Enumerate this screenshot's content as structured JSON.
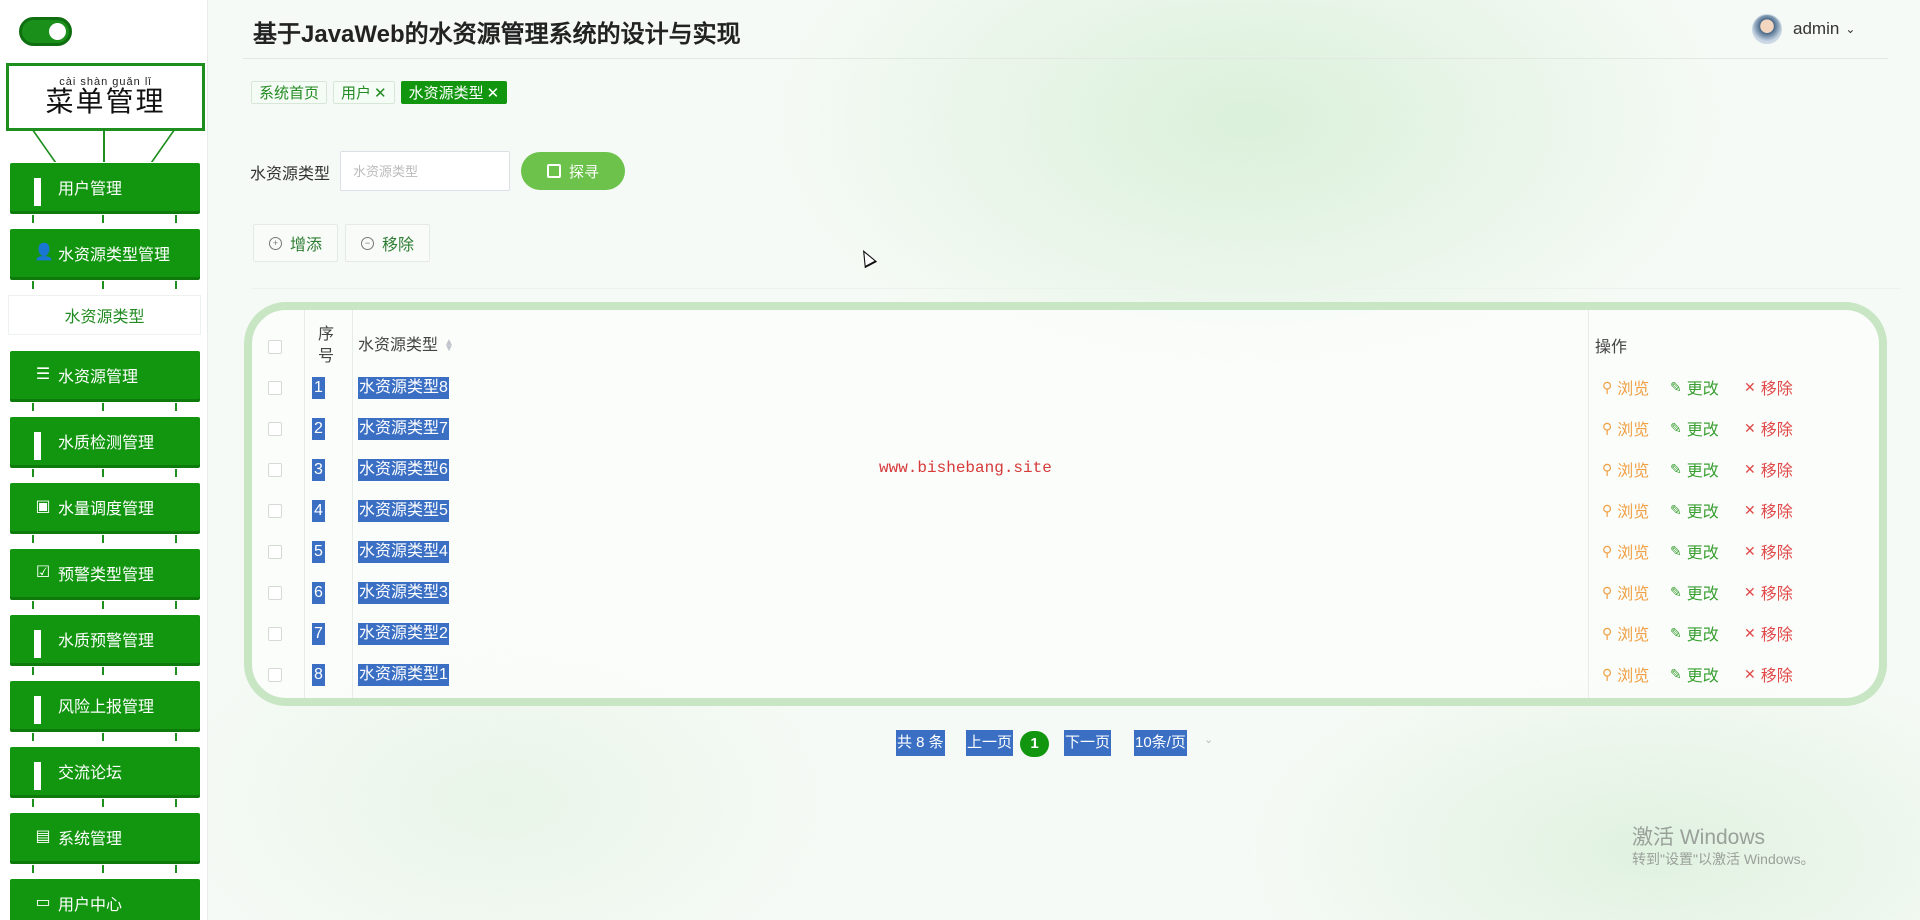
{
  "app": {
    "title": "基于JavaWeb的水资源管理系统的设计与实现",
    "user": "admin"
  },
  "sidebar": {
    "title_pinyin": "cài  shàn guǎn  lǐ",
    "title": "菜单管理",
    "items": [
      {
        "label": "用户管理",
        "icon": "grid-icon"
      },
      {
        "label": "水资源类型管理",
        "icon": "user-icon"
      },
      {
        "label": "水资源管理",
        "icon": "sliders-icon"
      },
      {
        "label": "水质检测管理",
        "icon": "grid-icon"
      },
      {
        "label": "水量调度管理",
        "icon": "wallet-icon"
      },
      {
        "label": "预警类型管理",
        "icon": "clipboard-check-icon"
      },
      {
        "label": "水质预警管理",
        "icon": "grid-icon"
      },
      {
        "label": "风险上报管理",
        "icon": "grid-icon"
      },
      {
        "label": "交流论坛",
        "icon": "grid-icon"
      },
      {
        "label": "系统管理",
        "icon": "briefcase-icon"
      },
      {
        "label": "用户中心",
        "icon": "card-icon"
      }
    ],
    "submenu_active": "水资源类型"
  },
  "tabs": [
    {
      "label": "系统首页",
      "closable": false
    },
    {
      "label": "用户",
      "closable": true
    },
    {
      "label": "水资源类型",
      "closable": true
    }
  ],
  "search": {
    "label": "水资源类型",
    "placeholder": "水资源类型",
    "button": "探寻"
  },
  "toolbar": {
    "add": "增添",
    "remove": "移除"
  },
  "table": {
    "headers": {
      "index": "序\n号",
      "type": "水资源类型",
      "actions": "操作"
    },
    "rows": [
      {
        "index": "1",
        "type": "水资源类型8"
      },
      {
        "index": "2",
        "type": "水资源类型7"
      },
      {
        "index": "3",
        "type": "水资源类型6"
      },
      {
        "index": "4",
        "type": "水资源类型5"
      },
      {
        "index": "5",
        "type": "水资源类型4"
      },
      {
        "index": "6",
        "type": "水资源类型3"
      },
      {
        "index": "7",
        "type": "水资源类型2"
      },
      {
        "index": "8",
        "type": "水资源类型1"
      }
    ],
    "actions": {
      "view": "浏览",
      "edit": "更改",
      "delete": "移除"
    }
  },
  "pagination": {
    "total": "共 8 条",
    "prev": "上一页",
    "current": "1",
    "next": "下一页",
    "page_size": "10条/页"
  },
  "watermark": "www.bishebang.site",
  "windows_notice": {
    "line1": "激活 Windows",
    "line2": "转到\"设置\"以激活 Windows。"
  },
  "colors": {
    "primary": "#12960f",
    "highlight": "#3a6fc4",
    "view": "#f0a045",
    "edit": "#3aa032",
    "delete": "#e04a4a"
  }
}
